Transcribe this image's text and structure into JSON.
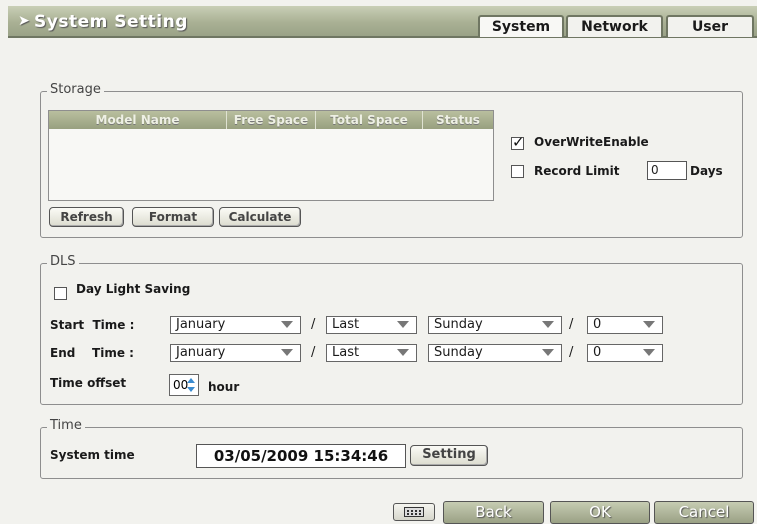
{
  "header": {
    "title": "System Setting"
  },
  "tabs": [
    {
      "label": "System"
    },
    {
      "label": "Network"
    },
    {
      "label": "User"
    }
  ],
  "storage": {
    "legend": "Storage",
    "columns": [
      "Model Name",
      "Free Space",
      "Total Space",
      "Status"
    ],
    "rows": [],
    "buttons": {
      "refresh": "Refresh",
      "format": "Format",
      "calculate": "Calculate"
    },
    "overwrite": {
      "label": "OverWriteEnable",
      "checked": true
    },
    "record_limit": {
      "label": "Record Limit",
      "value": "0",
      "unit": "Days",
      "checked": false
    }
  },
  "dls": {
    "legend": "DLS",
    "day_light_saving": {
      "label": "Day Light Saving",
      "checked": false
    },
    "start": {
      "label": "Start  Time :",
      "month": "January",
      "week": "Last",
      "day": "Sunday",
      "hour": "0"
    },
    "end": {
      "label": "End    Time :",
      "month": "January",
      "week": "Last",
      "day": "Sunday",
      "hour": "0"
    },
    "separator": "/",
    "offset": {
      "label": "Time offset",
      "value": "00",
      "unit": "hour"
    }
  },
  "time": {
    "legend": "Time",
    "label": "System time",
    "value": "03/05/2009 15:34:46",
    "setting_button": "Setting"
  },
  "footer": {
    "keyboard_icon": "keyboard-icon",
    "back": "Back",
    "ok": "OK",
    "cancel": "Cancel"
  }
}
